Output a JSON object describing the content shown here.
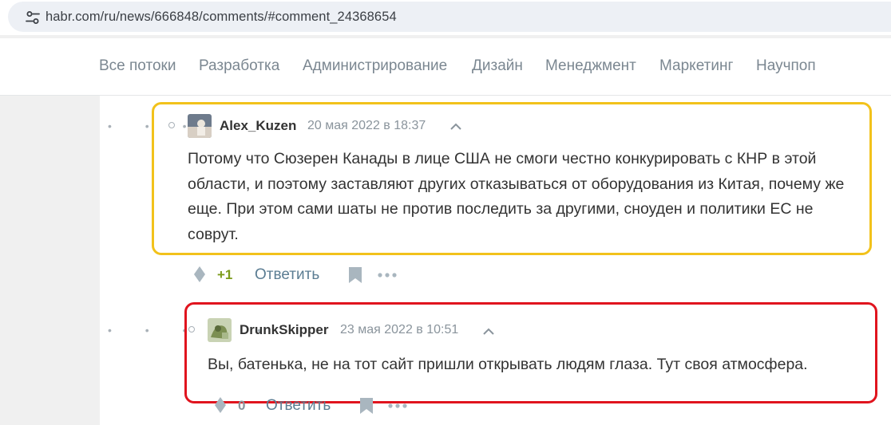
{
  "address_bar": {
    "url": "habr.com/ru/news/666848/comments/#comment_24368654"
  },
  "nav": {
    "items": [
      "Все потоки",
      "Разработка",
      "Администрирование",
      "Дизайн",
      "Менеджмент",
      "Маркетинг",
      "Научпоп"
    ]
  },
  "comments": [
    {
      "author": "Alex_Kuzen",
      "date": "20 мая 2022 в 18:37",
      "text": "Потому что Сюзерен Канады в лице США не смоги честно конкурировать с КНР в этой области, и поэтому заставляют других отказываться от оборудования из Китая, почему же еще. При этом сами шаты не против последить за другими, сноуден и политики ЕС не соврут.",
      "score": "+1",
      "score_color": "#7b9b1a",
      "reply_label": "Ответить",
      "highlight_color": "#f2c21b"
    },
    {
      "author": "DrunkSkipper",
      "date": "23 мая 2022 в 10:51",
      "text": "Вы, батенька, не на тот сайт пришли открывать людям глаза. Тут своя атмосфера.",
      "score": "0",
      "score_color": "#8a949c",
      "reply_label": "Ответить",
      "highlight_color": "#e0141e"
    }
  ],
  "icons": [
    "tune-icon",
    "avatar",
    "chevron-up-icon",
    "vote-icon",
    "bookmark-icon",
    "more-icon"
  ]
}
